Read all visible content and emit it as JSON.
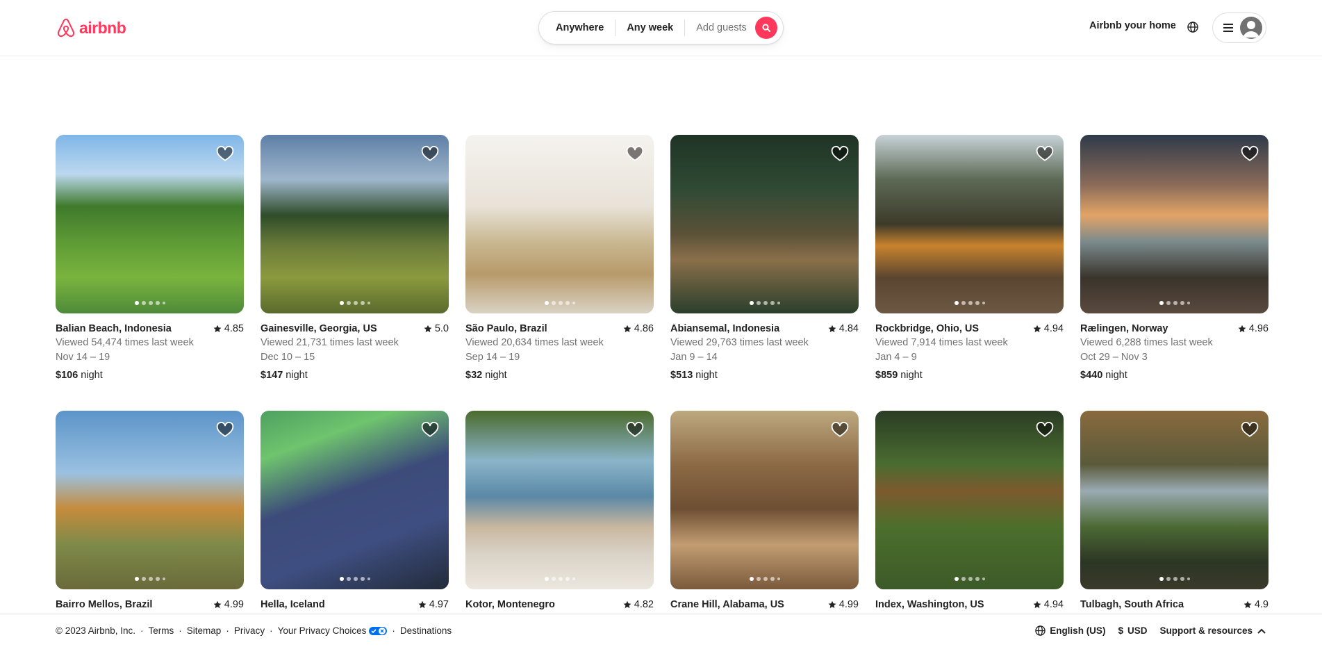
{
  "header": {
    "logo_text": "airbnb",
    "search": {
      "anywhere": "Anywhere",
      "any_week": "Any week",
      "add_guests": "Add guests"
    },
    "host_link": "Airbnb your home"
  },
  "listings": [
    {
      "location": "Balian Beach, Indonesia",
      "rating": "4.85",
      "views": "Viewed 54,474 times last week",
      "dates": "Nov 14 – 19",
      "price": "$106",
      "price_unit": "night"
    },
    {
      "location": "Gainesville, Georgia, US",
      "rating": "5.0",
      "views": "Viewed 21,731 times last week",
      "dates": "Dec 10 – 15",
      "price": "$147",
      "price_unit": "night"
    },
    {
      "location": "São Paulo, Brazil",
      "rating": "4.86",
      "views": "Viewed 20,634 times last week",
      "dates": "Sep 14 – 19",
      "price": "$32",
      "price_unit": "night"
    },
    {
      "location": "Abiansemal, Indonesia",
      "rating": "4.84",
      "views": "Viewed 29,763 times last week",
      "dates": "Jan 9 – 14",
      "price": "$513",
      "price_unit": "night"
    },
    {
      "location": "Rockbridge, Ohio, US",
      "rating": "4.94",
      "views": "Viewed 7,914 times last week",
      "dates": "Jan 4 – 9",
      "price": "$859",
      "price_unit": "night"
    },
    {
      "location": "Rælingen, Norway",
      "rating": "4.96",
      "views": "Viewed 6,288 times last week",
      "dates": "Oct 29 – Nov 3",
      "price": "$440",
      "price_unit": "night"
    },
    {
      "location": "Bairro Mellos, Brazil",
      "rating": "4.99"
    },
    {
      "location": "Hella, Iceland",
      "rating": "4.97"
    },
    {
      "location": "Kotor, Montenegro",
      "rating": "4.82"
    },
    {
      "location": "Crane Hill, Alabama, US",
      "rating": "4.99"
    },
    {
      "location": "Index, Washington, US",
      "rating": "4.94"
    },
    {
      "location": "Tulbagh, South Africa",
      "rating": "4.9"
    }
  ],
  "footer": {
    "copyright": "© 2023 Airbnb, Inc.",
    "terms": "Terms",
    "sitemap": "Sitemap",
    "privacy": "Privacy",
    "privacy_choices": "Your Privacy Choices",
    "destinations": "Destinations",
    "language": "English (US)",
    "currency_symbol": "$",
    "currency": "USD",
    "support": "Support & resources"
  },
  "colors": {
    "brand": "#FF385C",
    "text": "#222222",
    "muted": "#717171"
  }
}
